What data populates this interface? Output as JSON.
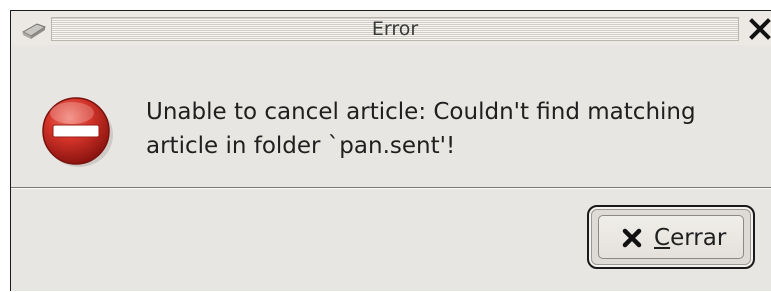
{
  "window": {
    "title": "Error"
  },
  "dialog": {
    "message_line_1": "Unable to cancel article: Couldn't find matching",
    "message_line_2": "article in folder `pan.sent'!",
    "icon": "error-no-entry-icon"
  },
  "buttons": {
    "close": {
      "mnemonic": "C",
      "label_rest": "errar",
      "icon": "close-x-icon"
    }
  },
  "colors": {
    "dialog_bg": "#e8e6e2",
    "error_red": "#c8241b",
    "text": "#1f1f1f"
  }
}
